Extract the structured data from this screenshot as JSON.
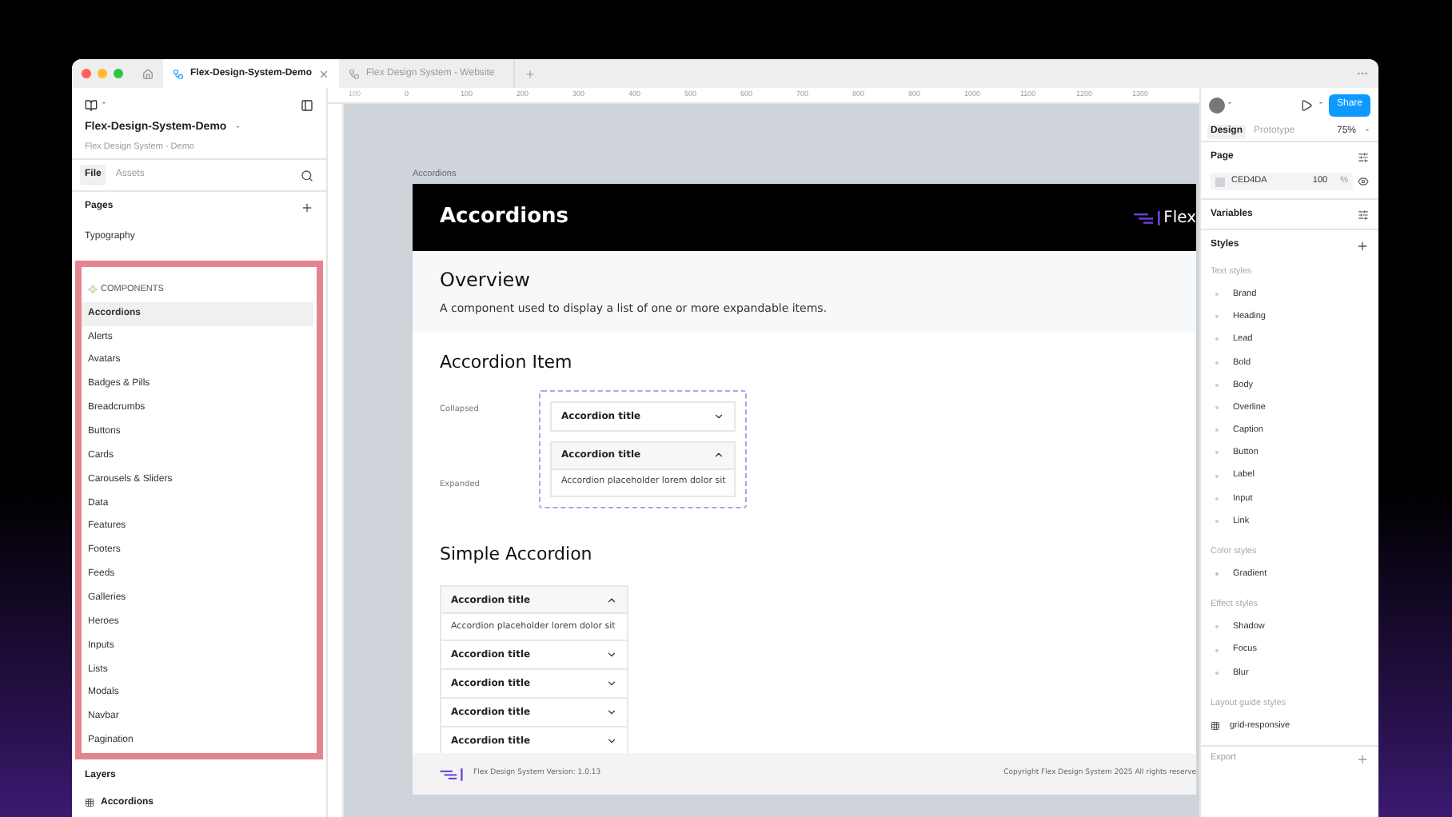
{
  "tabs": [
    {
      "label": "Flex-Design-System-Demo",
      "selected": true
    },
    {
      "label": "Flex Design System - Website",
      "selected": false
    }
  ],
  "left_panel": {
    "file_menu": "-",
    "title": "Flex-Design-System-Demo",
    "title_caret": "-",
    "subtitle": "Flex Design System - Demo",
    "panel_tabs": [
      {
        "label": "File",
        "selected": true
      },
      {
        "label": "Assets",
        "selected": false
      }
    ],
    "pages_heading": "Pages",
    "pages": [
      {
        "label": "Typography",
        "selected": false
      }
    ],
    "components_heading": "COMPONENTS",
    "components": [
      {
        "label": "Accordions",
        "selected": true
      },
      {
        "label": "Alerts",
        "selected": false
      },
      {
        "label": "Avatars",
        "selected": false
      },
      {
        "label": "Badges & Pills",
        "selected": false
      },
      {
        "label": "Breadcrumbs",
        "selected": false
      },
      {
        "label": "Buttons",
        "selected": false
      },
      {
        "label": "Cards",
        "selected": false
      },
      {
        "label": "Carousels & Sliders",
        "selected": false
      },
      {
        "label": "Data",
        "selected": false
      },
      {
        "label": "Features",
        "selected": false
      },
      {
        "label": "Footers",
        "selected": false
      },
      {
        "label": "Feeds",
        "selected": false
      },
      {
        "label": "Galleries",
        "selected": false
      },
      {
        "label": "Heroes",
        "selected": false
      },
      {
        "label": "Inputs",
        "selected": false
      },
      {
        "label": "Lists",
        "selected": false
      },
      {
        "label": "Modals",
        "selected": false
      },
      {
        "label": "Navbar",
        "selected": false
      },
      {
        "label": "Pagination",
        "selected": false
      }
    ],
    "layers_heading": "Layers",
    "layers": [
      {
        "label": "Accordions"
      }
    ]
  },
  "ruler": {
    "labels": [
      "100",
      "0",
      "100",
      "200",
      "300",
      "400",
      "500",
      "600",
      "700",
      "800",
      "900",
      "1000",
      "1100",
      "1200",
      "1300"
    ]
  },
  "canvas": {
    "frame_label": "Accordions",
    "header": {
      "title": "Accordions",
      "logo_text": "Flex"
    },
    "overview": {
      "title": "Overview",
      "text": "A component used to display a list of one or more expandable items."
    },
    "accordion_item": {
      "title": "Accordion Item",
      "states": [
        {
          "label": "Collapsed"
        },
        {
          "label": "Expanded"
        }
      ],
      "variants": [
        {
          "title": "Accordion title",
          "expanded": false
        },
        {
          "title": "Accordion title",
          "expanded": true,
          "body": "Accordion placeholder lorem dolor sit"
        }
      ]
    },
    "simple_accordion": {
      "title": "Simple Accordion",
      "items": [
        {
          "title": "Accordion title",
          "expanded": true,
          "body": "Accordion placeholder lorem dolor sit"
        },
        {
          "title": "Accordion title",
          "expanded": false
        },
        {
          "title": "Accordion title",
          "expanded": false
        },
        {
          "title": "Accordion title",
          "expanded": false
        },
        {
          "title": "Accordion title",
          "expanded": false
        }
      ]
    },
    "footer": {
      "version": "Flex Design System Version: 1.0.13",
      "copyright": "Copyright Flex Design System 2025 All rights reserve"
    }
  },
  "right_panel": {
    "avatar_caret": "-",
    "play_caret": "-",
    "share": "Share",
    "mode_tabs": [
      {
        "label": "Design",
        "selected": true
      },
      {
        "label": "Prototype",
        "selected": false
      }
    ],
    "zoom": "75%",
    "zoom_caret": "-",
    "page_heading": "Page",
    "page_color": {
      "hex": "CED4DA",
      "color": "#ced4da",
      "opacity": "100",
      "unit": "%"
    },
    "variables_heading": "Variables",
    "styles_heading": "Styles",
    "style_groups": [
      {
        "heading": "Text styles",
        "kind": "text",
        "items": [
          "Brand",
          "Heading",
          "Lead",
          "Bold",
          "Body",
          "Overline",
          "Caption",
          "Button",
          "Label",
          "Input",
          "Link"
        ]
      },
      {
        "heading": "Color styles",
        "kind": "color",
        "items": [
          "Gradient"
        ]
      },
      {
        "heading": "Effect styles",
        "kind": "effect",
        "items": [
          "Shadow",
          "Focus",
          "Blur"
        ]
      },
      {
        "heading": "Layout guide styles",
        "kind": "grid",
        "items": [
          "grid-responsive"
        ]
      }
    ],
    "export_heading": "Export"
  }
}
